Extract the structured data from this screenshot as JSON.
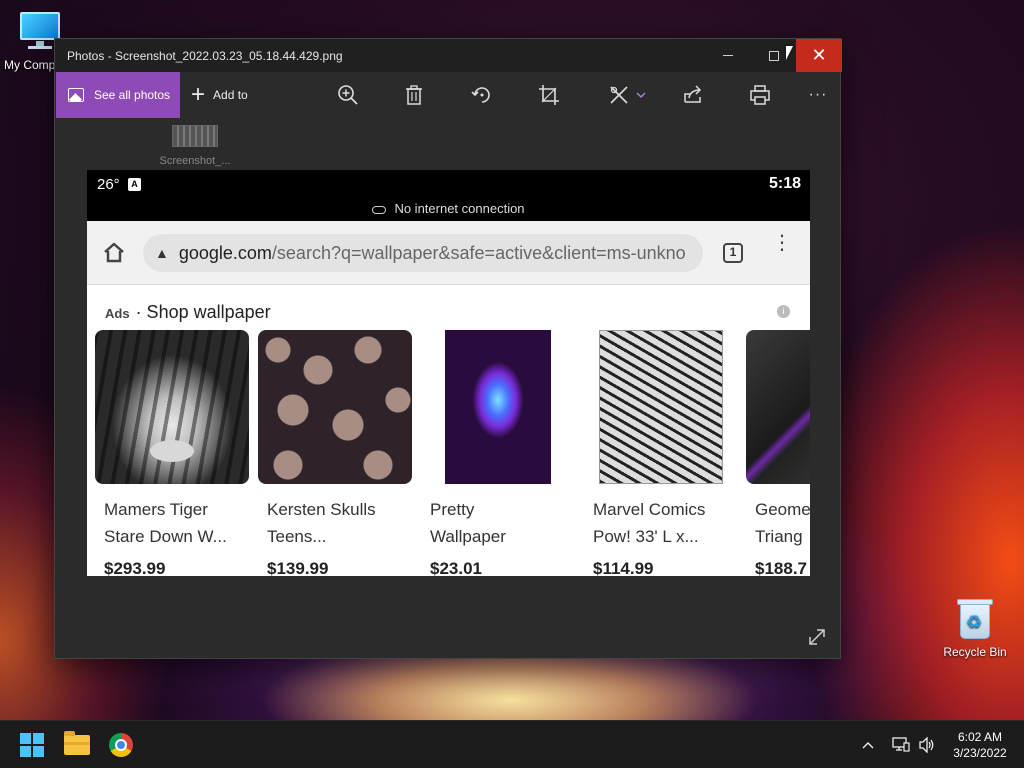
{
  "desktop": {
    "icons": [
      {
        "label": "My Computer"
      },
      {
        "label": "Recycle Bin"
      }
    ]
  },
  "window": {
    "title": "Photos - Screenshot_2022.03.23_05.18.44.429.png",
    "close_glyph": "✕",
    "toolbar": {
      "see_all_label": "See all photos",
      "add_to_label": "Add to",
      "add_glyph": "+",
      "more_glyph": "···"
    },
    "filmstrip": {
      "label": "Screenshot_..."
    },
    "accent_color": "#8e4bb5"
  },
  "photo": {
    "status": {
      "temp": "26°",
      "badge": "A",
      "time": "5:18",
      "no_internet": "No internet connection"
    },
    "browser": {
      "warning_glyph": "▲",
      "url_domain": "google.com",
      "url_path": "/search?q=wallpaper&safe=active&client=ms-unkno",
      "tab_count": "1",
      "menu_glyph": "⋮"
    },
    "shop": {
      "ads_label": "Ads",
      "heading": "· Shop wallpaper",
      "info_glyph": "i",
      "products": [
        {
          "name": "Mamers Tiger\nStare Down W...",
          "price": "$293.99"
        },
        {
          "name": "Kersten Skulls\nTeens...",
          "price": "$139.99"
        },
        {
          "name": "Pretty\nWallpaper",
          "price": "$23.01"
        },
        {
          "name": "Marvel Comics\nPow! 33' L x...",
          "price": "$114.99"
        },
        {
          "name": "Geome\nTriang",
          "price": "$188.7"
        }
      ]
    }
  },
  "taskbar": {
    "time": "6:02 AM",
    "date": "3/23/2022",
    "tray_chevron": "^",
    "network_glyph": "🖥",
    "volume_glyph": "🔊"
  }
}
